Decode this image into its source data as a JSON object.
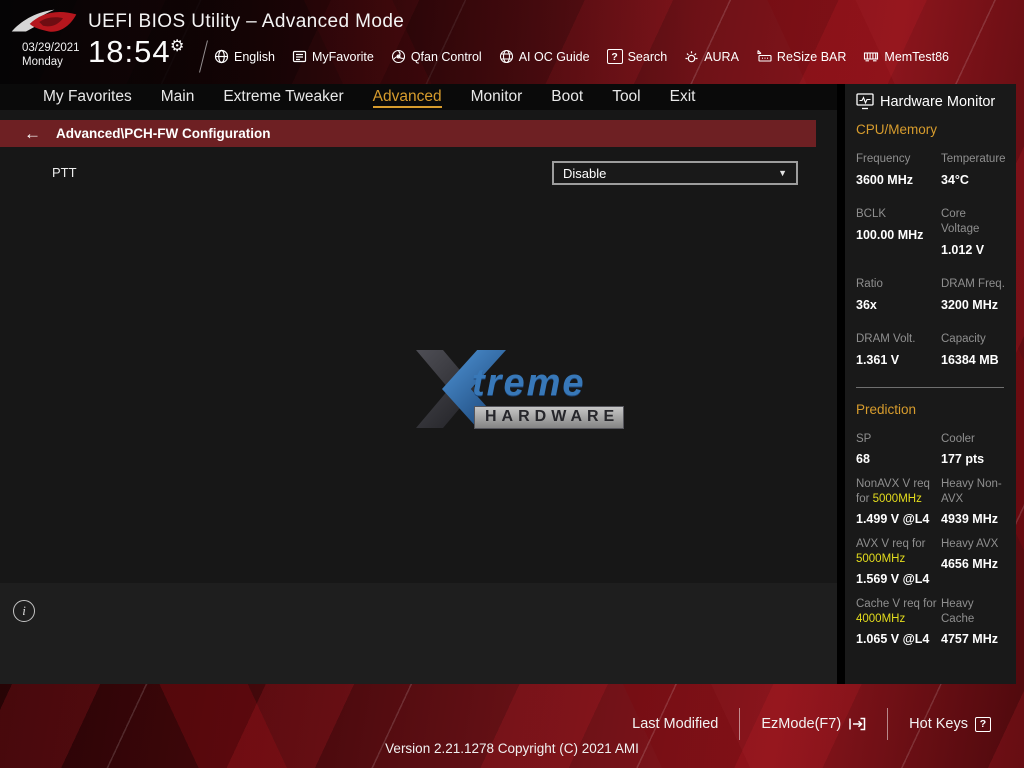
{
  "header": {
    "title": "UEFI BIOS Utility – Advanced Mode",
    "date": "03/29/2021",
    "day": "Monday",
    "time": "18:54",
    "toolbar": [
      {
        "icon": "globe-icon",
        "label": "English"
      },
      {
        "icon": "myfavorite-icon",
        "label": "MyFavorite"
      },
      {
        "icon": "qfan-icon",
        "label": "Qfan Control"
      },
      {
        "icon": "ai-oc-icon",
        "label": "AI OC Guide"
      },
      {
        "icon": "search-icon",
        "label": "Search"
      },
      {
        "icon": "aura-icon",
        "label": "AURA"
      },
      {
        "icon": "resize-bar-icon",
        "label": "ReSize BAR"
      },
      {
        "icon": "memtest-icon",
        "label": "MemTest86"
      }
    ]
  },
  "nav": {
    "tabs": [
      {
        "label": "My Favorites",
        "active": false
      },
      {
        "label": "Main",
        "active": false
      },
      {
        "label": "Extreme Tweaker",
        "active": false
      },
      {
        "label": "Advanced",
        "active": true
      },
      {
        "label": "Monitor",
        "active": false
      },
      {
        "label": "Boot",
        "active": false
      },
      {
        "label": "Tool",
        "active": false
      },
      {
        "label": "Exit",
        "active": false
      }
    ]
  },
  "breadcrumb": {
    "path": "Advanced\\PCH-FW Configuration"
  },
  "main": {
    "settings": [
      {
        "label": "PTT",
        "value": "Disable"
      }
    ]
  },
  "watermark": {
    "text": "treme",
    "sub": "HARDWARE"
  },
  "sidebar": {
    "title": "Hardware Monitor",
    "cpu_memory": {
      "heading": "CPU/Memory",
      "rows": [
        {
          "l1": "Frequency",
          "v1": "3600 MHz",
          "l2": "Temperature",
          "v2": "34°C"
        },
        {
          "l1": "BCLK",
          "v1": "100.00 MHz",
          "l2": "Core Voltage",
          "v2": "1.012 V"
        },
        {
          "l1": "Ratio",
          "v1": "36x",
          "l2": "DRAM Freq.",
          "v2": "3200 MHz"
        },
        {
          "l1": "DRAM Volt.",
          "v1": "1.361 V",
          "l2": "Capacity",
          "v2": "16384 MB"
        }
      ]
    },
    "prediction": {
      "heading": "Prediction",
      "rows": [
        {
          "l1_pre": "SP",
          "l1_hl": "",
          "v1": "68",
          "l2": "Cooler",
          "v2": "177 pts"
        },
        {
          "l1_pre": "NonAVX V req for ",
          "l1_hl": "5000MHz",
          "v1": "1.499 V @L4",
          "l2": "Heavy Non-AVX",
          "v2": "4939 MHz"
        },
        {
          "l1_pre": "AVX V req for ",
          "l1_hl": "5000MHz",
          "v1": "1.569 V @L4",
          "l2": "Heavy AVX",
          "v2": "4656 MHz"
        },
        {
          "l1_pre": "Cache V req for ",
          "l1_hl": "4000MHz",
          "v1": "1.065 V @L4",
          "l2": "Heavy Cache",
          "v2": "4757 MHz"
        }
      ]
    }
  },
  "bottom_bar": {
    "last_modified": "Last Modified",
    "ezmode": "EzMode(F7)",
    "hot_keys": "Hot Keys"
  },
  "footer": {
    "version": "Version 2.21.1278 Copyright (C) 2021 AMI"
  },
  "colors": {
    "accent_gold": "#d79c2d",
    "highlight_yellow": "#e3dc1d",
    "breadcrumb_maroon": "#6e2023",
    "watermark_blue": "#3878b8",
    "rog_red": "#b5161d"
  }
}
